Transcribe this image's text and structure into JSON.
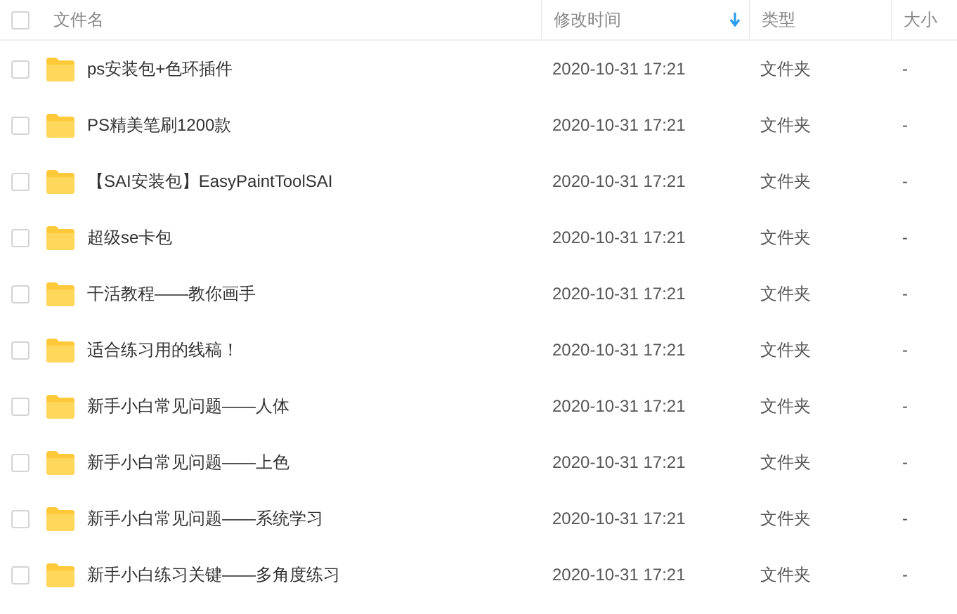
{
  "header": {
    "select_all": {
      "checked": false
    },
    "columns": [
      {
        "label": "文件名",
        "sorted": false
      },
      {
        "label": "修改时间",
        "sorted": true
      },
      {
        "label": "类型",
        "sorted": false
      },
      {
        "label": "大小",
        "sorted": false
      }
    ]
  },
  "rows": [
    {
      "name": "ps安装包+色环插件",
      "modified": "2020-10-31 17:21",
      "type": "文件夹",
      "size": "-",
      "checked": false
    },
    {
      "name": "PS精美笔刷1200款",
      "modified": "2020-10-31 17:21",
      "type": "文件夹",
      "size": "-",
      "checked": false
    },
    {
      "name": "【SAI安装包】EasyPaintToolSAI",
      "modified": "2020-10-31 17:21",
      "type": "文件夹",
      "size": "-",
      "checked": false
    },
    {
      "name": "超级se卡包",
      "modified": "2020-10-31 17:21",
      "type": "文件夹",
      "size": "-",
      "checked": false
    },
    {
      "name": "干活教程——教你画手",
      "modified": "2020-10-31 17:21",
      "type": "文件夹",
      "size": "-",
      "checked": false
    },
    {
      "name": "适合练习用的线稿！",
      "modified": "2020-10-31 17:21",
      "type": "文件夹",
      "size": "-",
      "checked": false
    },
    {
      "name": "新手小白常见问题——人体",
      "modified": "2020-10-31 17:21",
      "type": "文件夹",
      "size": "-",
      "checked": false
    },
    {
      "name": "新手小白常见问题——上色",
      "modified": "2020-10-31 17:21",
      "type": "文件夹",
      "size": "-",
      "checked": false
    },
    {
      "name": "新手小白常见问题——系统学习",
      "modified": "2020-10-31 17:21",
      "type": "文件夹",
      "size": "-",
      "checked": false
    },
    {
      "name": "新手小白练习关键——多角度练习",
      "modified": "2020-10-31 17:21",
      "type": "文件夹",
      "size": "-",
      "checked": false
    }
  ]
}
